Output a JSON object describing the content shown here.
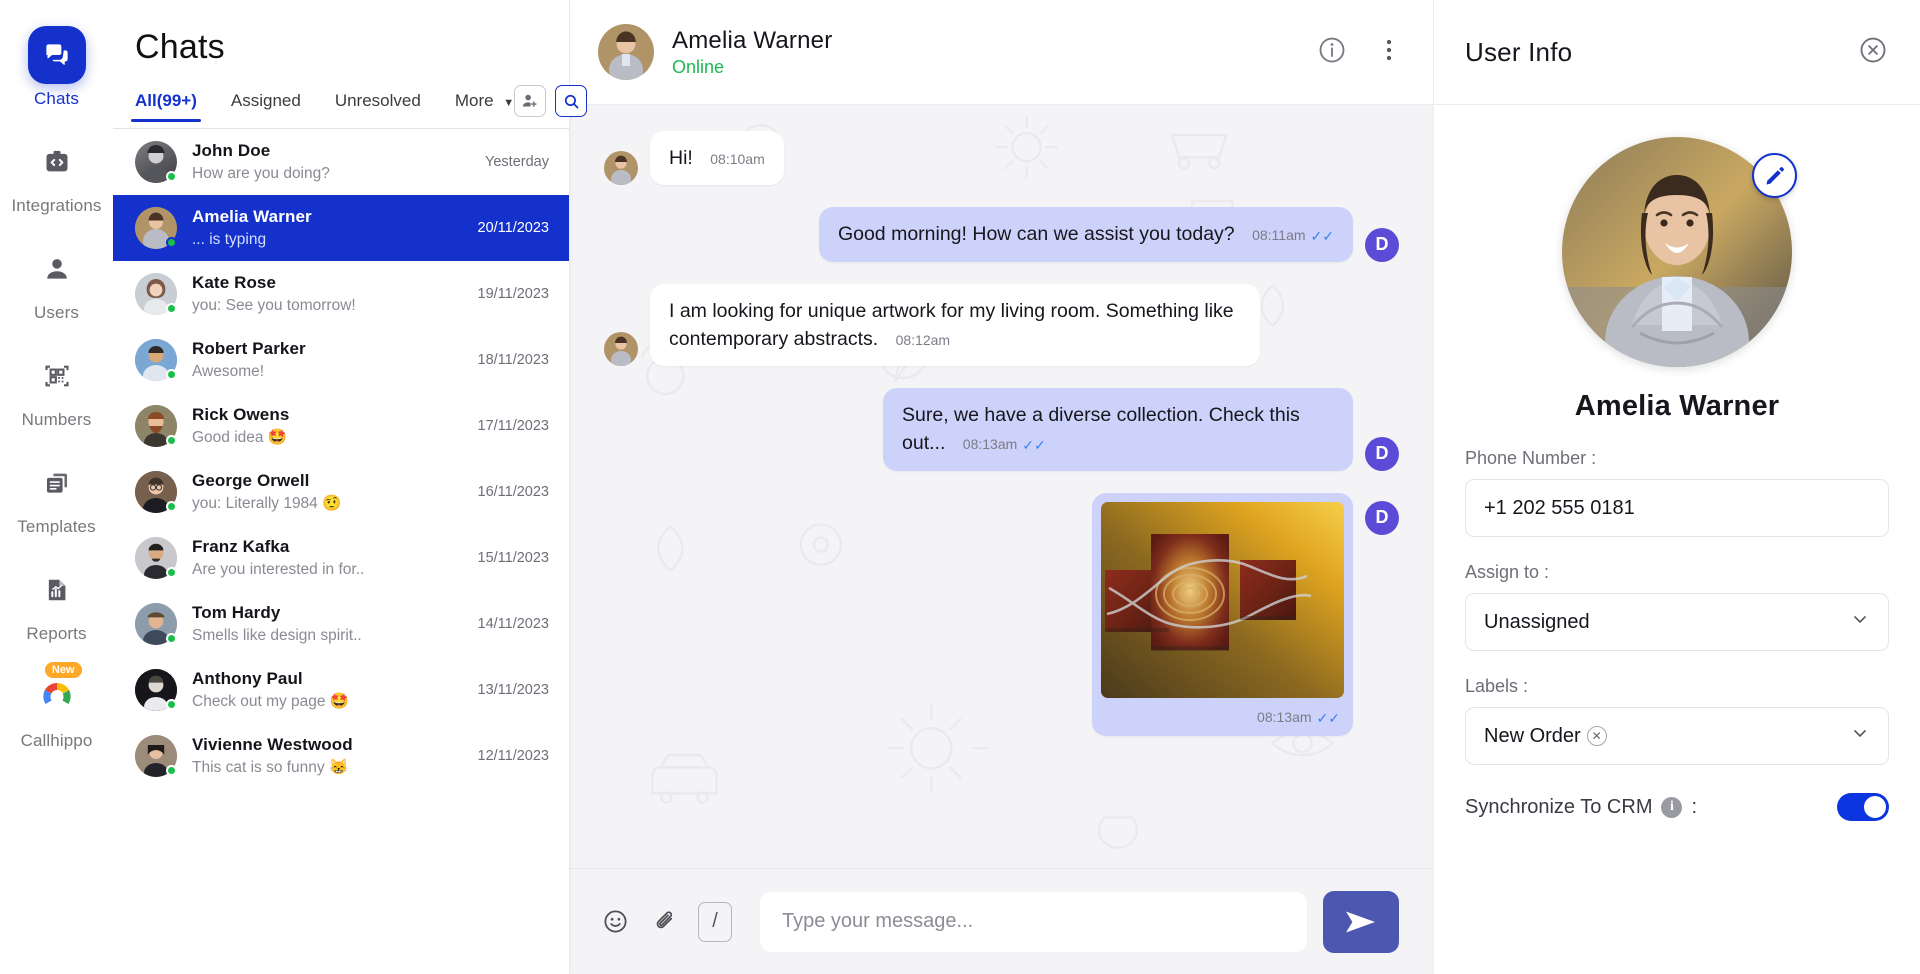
{
  "rail": {
    "items": [
      {
        "label": "Chats",
        "icon": "chat-icon",
        "active": true
      },
      {
        "label": "Integrations",
        "icon": "integrations-icon",
        "active": false
      },
      {
        "label": "Users",
        "icon": "users-icon",
        "active": false
      },
      {
        "label": "Numbers",
        "icon": "numbers-icon",
        "active": false
      },
      {
        "label": "Templates",
        "icon": "templates-icon",
        "active": false
      },
      {
        "label": "Reports",
        "icon": "reports-icon",
        "active": false
      },
      {
        "label": "Callhippo",
        "icon": "callhippo-logo-icon",
        "active": false,
        "badge": "New"
      }
    ]
  },
  "chatlist": {
    "title": "Chats",
    "tabs": [
      {
        "label": "All(99+)",
        "active": true
      },
      {
        "label": "Assigned",
        "active": false
      },
      {
        "label": "Unresolved",
        "active": false
      },
      {
        "label": "More",
        "active": false,
        "caret": "▼"
      }
    ],
    "rows": [
      {
        "name": "John Doe",
        "preview": "How are you doing?",
        "date": "Yesterday",
        "selected": false,
        "typing": false,
        "online": true
      },
      {
        "name": "Amelia Warner",
        "preview": "... is typing",
        "date": "20/11/2023",
        "selected": true,
        "typing": true,
        "online": true
      },
      {
        "name": "Kate Rose",
        "preview": "you: See you tomorrow!",
        "date": "19/11/2023",
        "selected": false,
        "typing": false,
        "online": true
      },
      {
        "name": "Robert Parker",
        "preview": "Awesome!",
        "date": "18/11/2023",
        "selected": false,
        "typing": false,
        "online": true
      },
      {
        "name": "Rick Owens",
        "preview": "Good idea 🤩",
        "date": "17/11/2023",
        "selected": false,
        "typing": false,
        "online": true
      },
      {
        "name": "George Orwell",
        "preview": "you: Literally 1984 🤨",
        "date": "16/11/2023",
        "selected": false,
        "typing": false,
        "online": true
      },
      {
        "name": "Franz Kafka",
        "preview": "Are you interested in for..",
        "date": "15/11/2023",
        "selected": false,
        "typing": false,
        "online": true
      },
      {
        "name": "Tom Hardy",
        "preview": "Smells like design spirit..",
        "date": "14/11/2023",
        "selected": false,
        "typing": false,
        "online": true
      },
      {
        "name": "Anthony Paul",
        "preview": "Check out my page 🤩",
        "date": "13/11/2023",
        "selected": false,
        "typing": false,
        "online": true
      },
      {
        "name": "Vivienne Westwood",
        "preview": "This cat is so funny 😸",
        "date": "12/11/2023",
        "selected": false,
        "typing": false,
        "online": true
      }
    ]
  },
  "chat": {
    "header": {
      "name": "Amelia Warner",
      "status": "Online"
    },
    "messages": [
      {
        "dir": "in",
        "text": "Hi!",
        "time": "08:10am",
        "type": "text"
      },
      {
        "dir": "out",
        "text": "Good morning! How can we assist you today?",
        "time": "08:11am",
        "type": "text",
        "avatar_initial": "D",
        "read": true
      },
      {
        "dir": "in",
        "text": "I am looking for unique artwork for my living room. Something like contemporary abstracts.",
        "time": "08:12am",
        "type": "text"
      },
      {
        "dir": "out",
        "text": "Sure, we have a diverse collection. Check this out...",
        "time": "08:13am",
        "type": "text",
        "avatar_initial": "D",
        "read": true
      },
      {
        "dir": "out",
        "text": "",
        "time": "08:13am",
        "type": "image",
        "avatar_initial": "D",
        "read": true,
        "alt": "abstract-triptych-artwork"
      }
    ],
    "composer": {
      "placeholder": "Type your message...",
      "value": "",
      "slash": "/"
    }
  },
  "userinfo": {
    "title": "User Info",
    "name": "Amelia Warner",
    "phone_label": "Phone Number :",
    "phone_value": "+1 202 555 0181",
    "assign_label": "Assign to :",
    "assign_value": "Unassigned",
    "labels_label": "Labels :",
    "label_chip": "New Order",
    "crm_label": "Synchronize To CRM",
    "crm_colon": ":",
    "crm_enabled": true
  },
  "colors": {
    "accent": "#1431CC",
    "bubble_out": "#cdd2fb",
    "online": "#1DB954",
    "badge": "#FFA726",
    "send": "#4C57B0"
  }
}
